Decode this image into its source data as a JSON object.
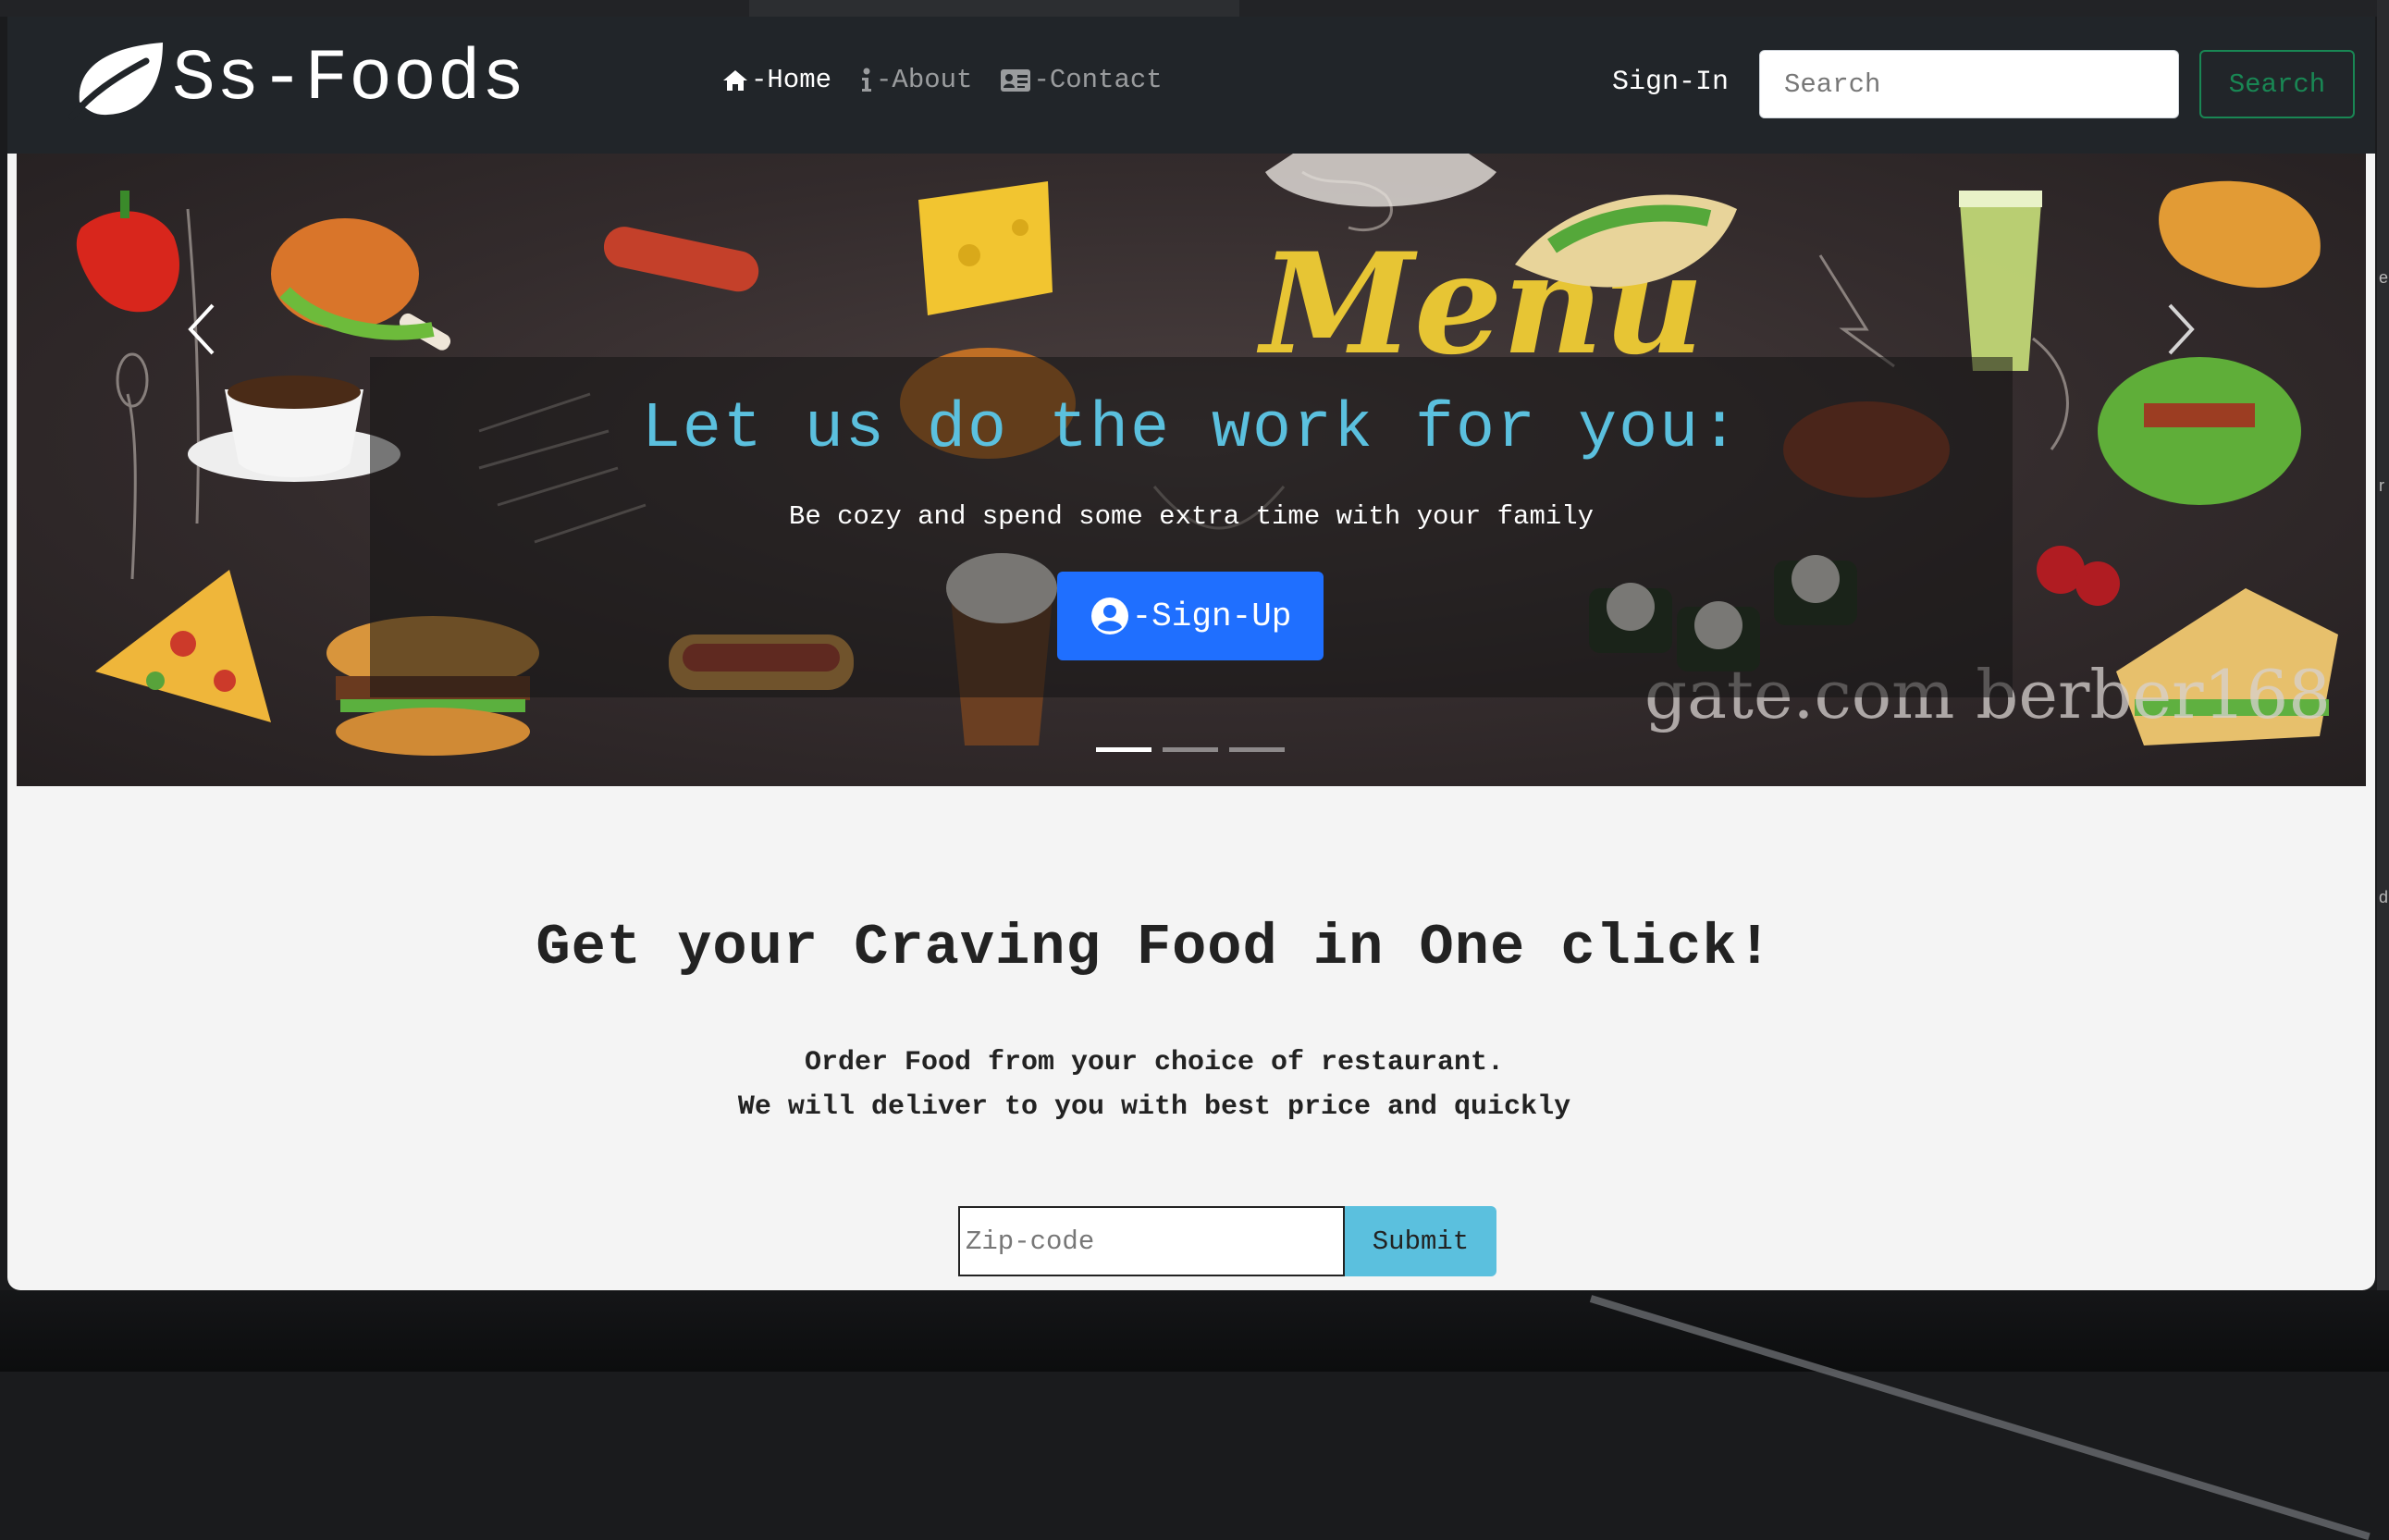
{
  "brand": {
    "name": "Ss-Foods"
  },
  "nav": {
    "home": "-Home",
    "about": "-About",
    "contact": "-Contact"
  },
  "header": {
    "signin": "Sign-In",
    "search_placeholder": "Search",
    "search_button": "Search"
  },
  "carousel": {
    "title": "Let us do the work for you:",
    "subtitle": "Be cozy and spend some extra time with your family",
    "signup_label": "-Sign-Up",
    "slides": 3,
    "active_slide": 1,
    "image_text": {
      "menu": "Menu",
      "watermark": "gate.com  berber168"
    }
  },
  "main": {
    "headline": "Get your Craving Food in One click!",
    "lead_line1": "Order Food from your choice of restaurant.",
    "lead_line2": "We will deliver to you with best price and quickly",
    "zip_placeholder": "Zip-code",
    "submit_label": "Submit"
  },
  "colors": {
    "navbar": "#212529",
    "accent_cyan": "#5bc0de",
    "signup_blue": "#1f6fff",
    "search_green": "#198754",
    "page_bg": "#f4f4f4"
  }
}
